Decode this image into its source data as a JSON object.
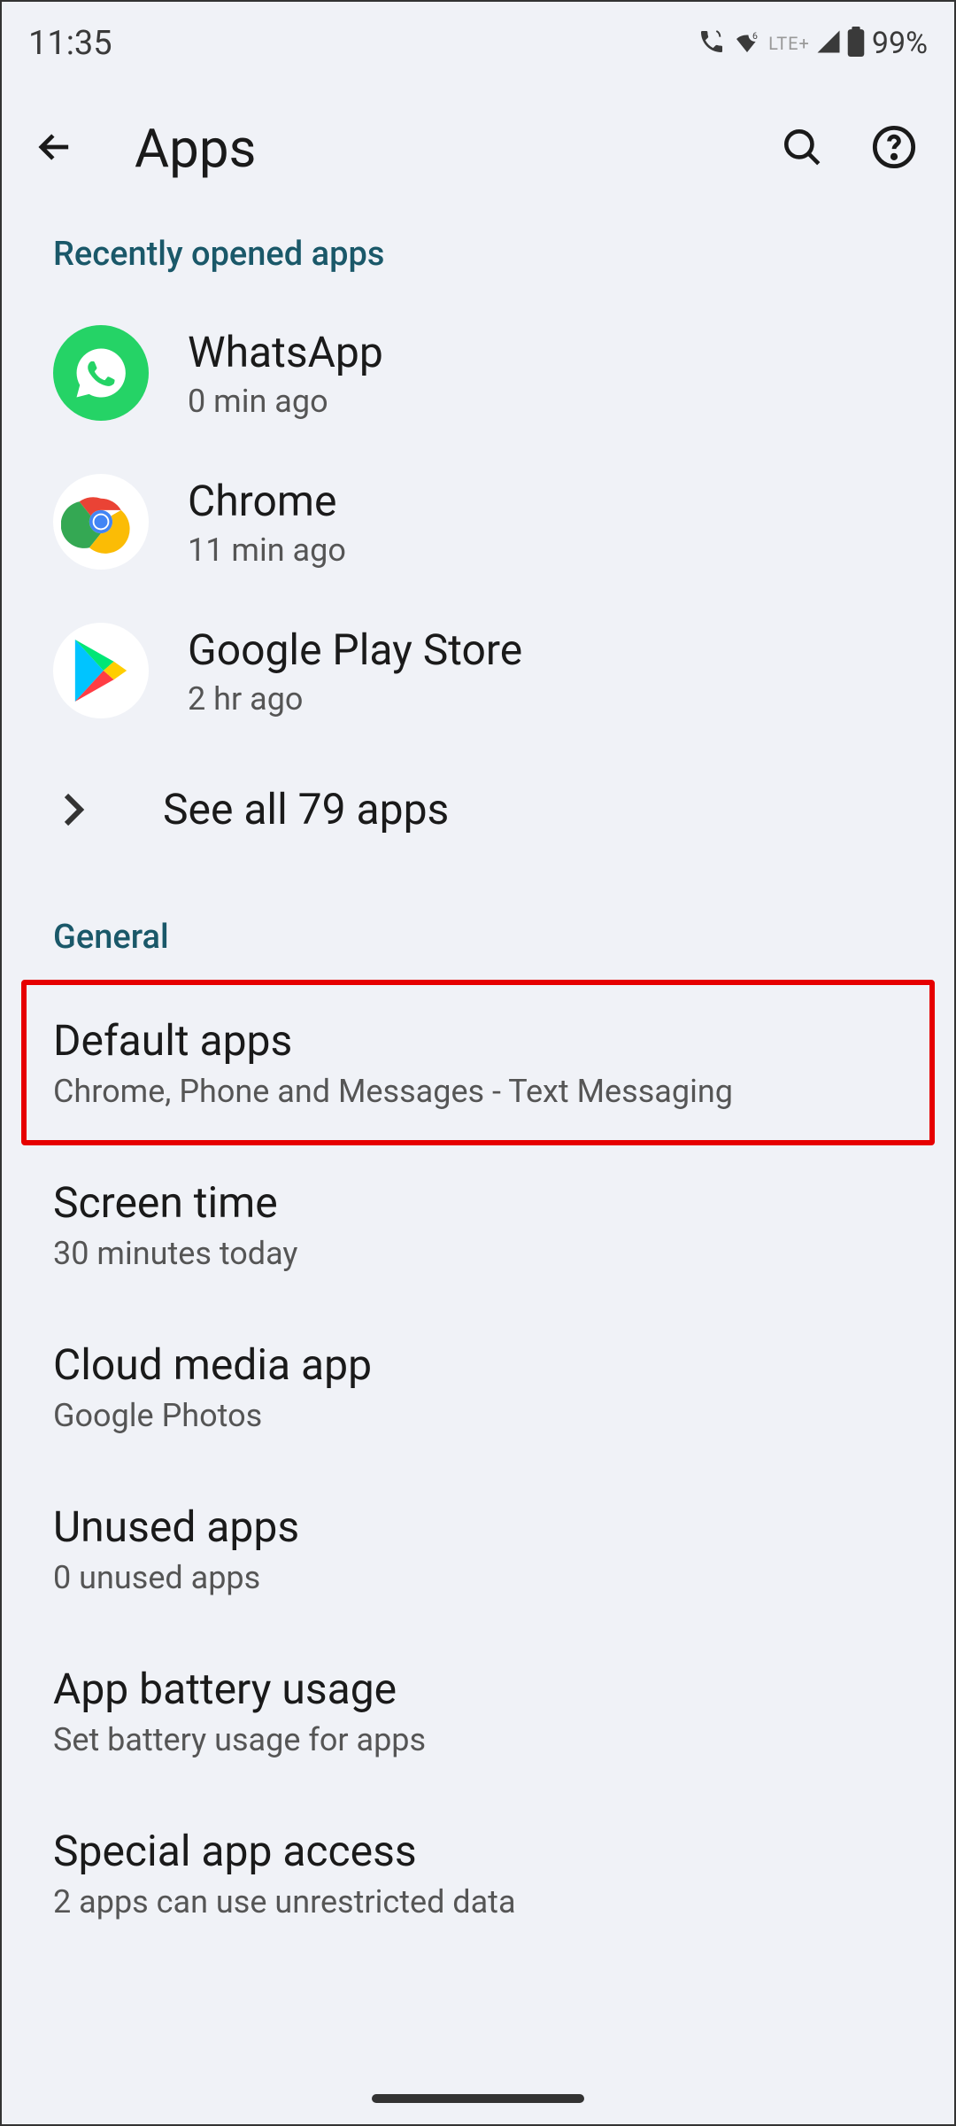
{
  "status": {
    "time": "11:35",
    "lte": "LTE+",
    "battery": "99%"
  },
  "header": {
    "title": "Apps"
  },
  "sections": {
    "recent": {
      "label": "Recently opened apps",
      "apps": [
        {
          "name": "WhatsApp",
          "time": "0 min ago"
        },
        {
          "name": "Chrome",
          "time": "11 min ago"
        },
        {
          "name": "Google Play Store",
          "time": "2 hr ago"
        }
      ],
      "seeAll": "See all 79 apps"
    },
    "general": {
      "label": "General",
      "items": [
        {
          "title": "Default apps",
          "subtitle": "Chrome, Phone and Messages - Text Messaging"
        },
        {
          "title": "Screen time",
          "subtitle": "30 minutes today"
        },
        {
          "title": "Cloud media app",
          "subtitle": "Google Photos"
        },
        {
          "title": "Unused apps",
          "subtitle": "0 unused apps"
        },
        {
          "title": "App battery usage",
          "subtitle": "Set battery usage for apps"
        },
        {
          "title": "Special app access",
          "subtitle": "2 apps can use unrestricted data"
        }
      ]
    }
  }
}
